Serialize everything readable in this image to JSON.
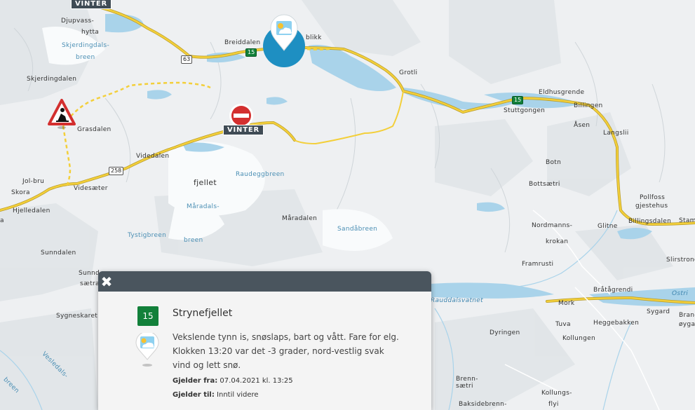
{
  "map": {
    "places": [
      {
        "id": "djupvass",
        "text": "Djupvass-"
      },
      {
        "id": "hytta",
        "text": "hytta"
      },
      {
        "id": "skjerdingdals",
        "text": "Skjerdingdals-"
      },
      {
        "id": "breen1",
        "text": "breen"
      },
      {
        "id": "skjerdingdalen",
        "text": "Skjerdingdalen"
      },
      {
        "id": "breiddalen",
        "text": "Breiddalen"
      },
      {
        "id": "blikk",
        "text": "blikk"
      },
      {
        "id": "grotli",
        "text": "Grotli"
      },
      {
        "id": "eldhusgrende",
        "text": "Eldhusgrende"
      },
      {
        "id": "stuttgongen",
        "text": "Stuttgongen"
      },
      {
        "id": "billingen",
        "text": "Billingen"
      },
      {
        "id": "asen",
        "text": "Åsen"
      },
      {
        "id": "langslii",
        "text": "Langslii"
      },
      {
        "id": "grasdalen",
        "text": "Grasdalen"
      },
      {
        "id": "videdalen",
        "text": "Videdalen"
      },
      {
        "id": "joljbru",
        "text": "Jol-bru"
      },
      {
        "id": "skora",
        "text": "Skora"
      },
      {
        "id": "videsaeter",
        "text": "Videsæter"
      },
      {
        "id": "hjelledalen",
        "text": "Hjelledalen"
      },
      {
        "id": "fjellet",
        "text": "fjellet"
      },
      {
        "id": "raudeggbreen",
        "text": "Raudeggbreen"
      },
      {
        "id": "maradals",
        "text": "Måradals-"
      },
      {
        "id": "breen2",
        "text": "breen"
      },
      {
        "id": "tystigbreen",
        "text": "Tystigbreen"
      },
      {
        "id": "maradalen",
        "text": "Måradalen"
      },
      {
        "id": "sandabreen",
        "text": "Sandåbreen"
      },
      {
        "id": "botn",
        "text": "Botn"
      },
      {
        "id": "bottsaetri",
        "text": "Bottsætri"
      },
      {
        "id": "pollfoss",
        "text": "Pollfoss"
      },
      {
        "id": "gjestehus",
        "text": "gjestehus"
      },
      {
        "id": "nordmanns",
        "text": "Nordmanns-"
      },
      {
        "id": "krokan",
        "text": "krokan"
      },
      {
        "id": "glitne",
        "text": "Glitne"
      },
      {
        "id": "billingsdalen",
        "text": "Billingsdalen"
      },
      {
        "id": "stam",
        "text": "Stam"
      },
      {
        "id": "slirstrond",
        "text": "Slirstrond"
      },
      {
        "id": "framrusti",
        "text": "Framrusti"
      },
      {
        "id": "bratagrendi",
        "text": "Bråtågrendi"
      },
      {
        "id": "ostri",
        "text": "Ostri"
      },
      {
        "id": "rauddalsvatnet",
        "text": "Rauddalsvatnet"
      },
      {
        "id": "mork",
        "text": "Mork"
      },
      {
        "id": "sygard",
        "text": "Sygard"
      },
      {
        "id": "brand",
        "text": "Brand"
      },
      {
        "id": "oygard",
        "text": "øygar"
      },
      {
        "id": "tuva",
        "text": "Tuva"
      },
      {
        "id": "heggebakken",
        "text": "Heggebakken"
      },
      {
        "id": "kollungen",
        "text": "Kollungen"
      },
      {
        "id": "dyringen",
        "text": "Dyringen"
      },
      {
        "id": "sunndalen",
        "text": "Sunndalen"
      },
      {
        "id": "sunnd",
        "text": "Sunnd"
      },
      {
        "id": "saetra",
        "text": "sætra"
      },
      {
        "id": "sygneskaret",
        "text": "Sygneskaret"
      },
      {
        "id": "vesledals",
        "text": "Vesledals-"
      },
      {
        "id": "breen3",
        "text": "breen"
      },
      {
        "id": "brenn1",
        "text": "Brenn-"
      },
      {
        "id": "saetri2",
        "text": "sætri"
      },
      {
        "id": "kollungs",
        "text": "Kollungs-"
      },
      {
        "id": "flyi",
        "text": "flyi"
      },
      {
        "id": "baksidebrenn",
        "text": "Baksidebrenn-"
      },
      {
        "id": "a-left",
        "text": "a"
      }
    ],
    "road_shields": [
      {
        "id": "r15a",
        "text": "15",
        "style": "green"
      },
      {
        "id": "r15b",
        "text": "15",
        "style": "green"
      },
      {
        "id": "r63",
        "text": "63",
        "style": "white"
      },
      {
        "id": "r258",
        "text": "258",
        "style": "white"
      }
    ],
    "markers": {
      "vinter_top": "VINTER",
      "vinter_closed": "VINTER"
    },
    "colors": {
      "road": "#f3cf3a",
      "water": "#a9d3ea",
      "land": "#eef0f2",
      "closed_road": "#f3cf3a",
      "weather_circle": "#1e8fc2"
    }
  },
  "popup": {
    "road_number": "15",
    "title": "Strynefjellet",
    "description": "Vekslende tynn is, snøslaps, bart og vått. Fare for elg. Klokken 13:20 var det -3 grader, nord-vestlig svak vind og lett snø.",
    "valid_from_label": "Gjelder fra:",
    "valid_from_value": "07.04.2021 kl. 13:25",
    "valid_to_label": "Gjelder til:",
    "valid_to_value": "Inntil videre"
  }
}
